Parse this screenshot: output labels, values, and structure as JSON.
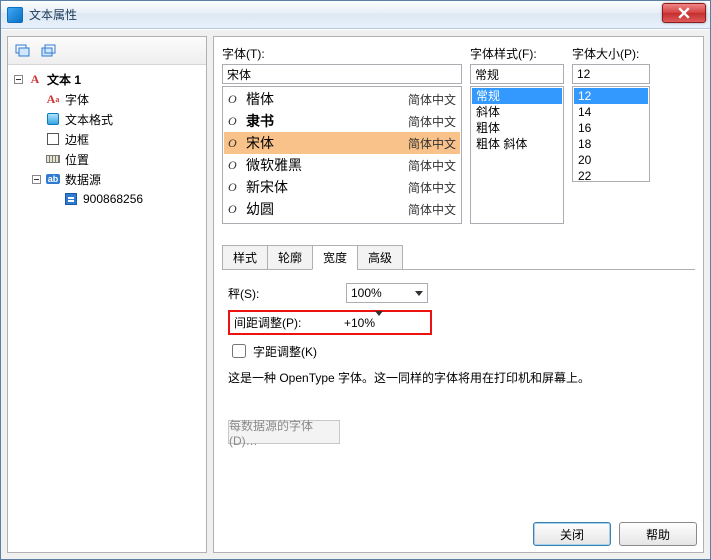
{
  "window": {
    "title": "文本属性"
  },
  "sidebar": {
    "root_label": "文本 1",
    "items": [
      {
        "label": "字体"
      },
      {
        "label": "文本格式"
      },
      {
        "label": "边框"
      },
      {
        "label": "位置"
      },
      {
        "label": "数据源",
        "child": "900868256"
      }
    ]
  },
  "font": {
    "label": "字体(T):",
    "value": "宋体",
    "list": [
      {
        "name": "楷体",
        "tag": "简体中文"
      },
      {
        "name": "隶书",
        "tag": "简体中文",
        "bold": true
      },
      {
        "name": "宋体",
        "tag": "简体中文",
        "selected": true
      },
      {
        "name": "微软雅黑",
        "tag": "简体中文"
      },
      {
        "name": "新宋体",
        "tag": "简体中文"
      },
      {
        "name": "幼圆",
        "tag": "简体中文"
      }
    ]
  },
  "style": {
    "label": "字体样式(F):",
    "value": "常规",
    "list": [
      "常规",
      "斜体",
      "粗体",
      "粗体 斜体"
    ],
    "selected_index": 0
  },
  "size": {
    "label": "字体大小(P):",
    "value": "12",
    "list": [
      "12",
      "14",
      "16",
      "18",
      "20",
      "22"
    ],
    "selected_index": 0
  },
  "tabs": {
    "items": [
      "样式",
      "轮廓",
      "宽度",
      "高级"
    ],
    "active_index": 2
  },
  "pane": {
    "scale_label": "秤(S):",
    "scale_value": "100%",
    "spacing_label": "间距调整(P):",
    "spacing_value": "+10%",
    "kerning_label": "字距调整(K)",
    "info": "这是一种 OpenType 字体。这一同样的字体将用在打印机和屏幕上。",
    "disabled_btn": "每数据源的字体(D)…"
  },
  "footer": {
    "close": "关闭",
    "help": "帮助"
  }
}
